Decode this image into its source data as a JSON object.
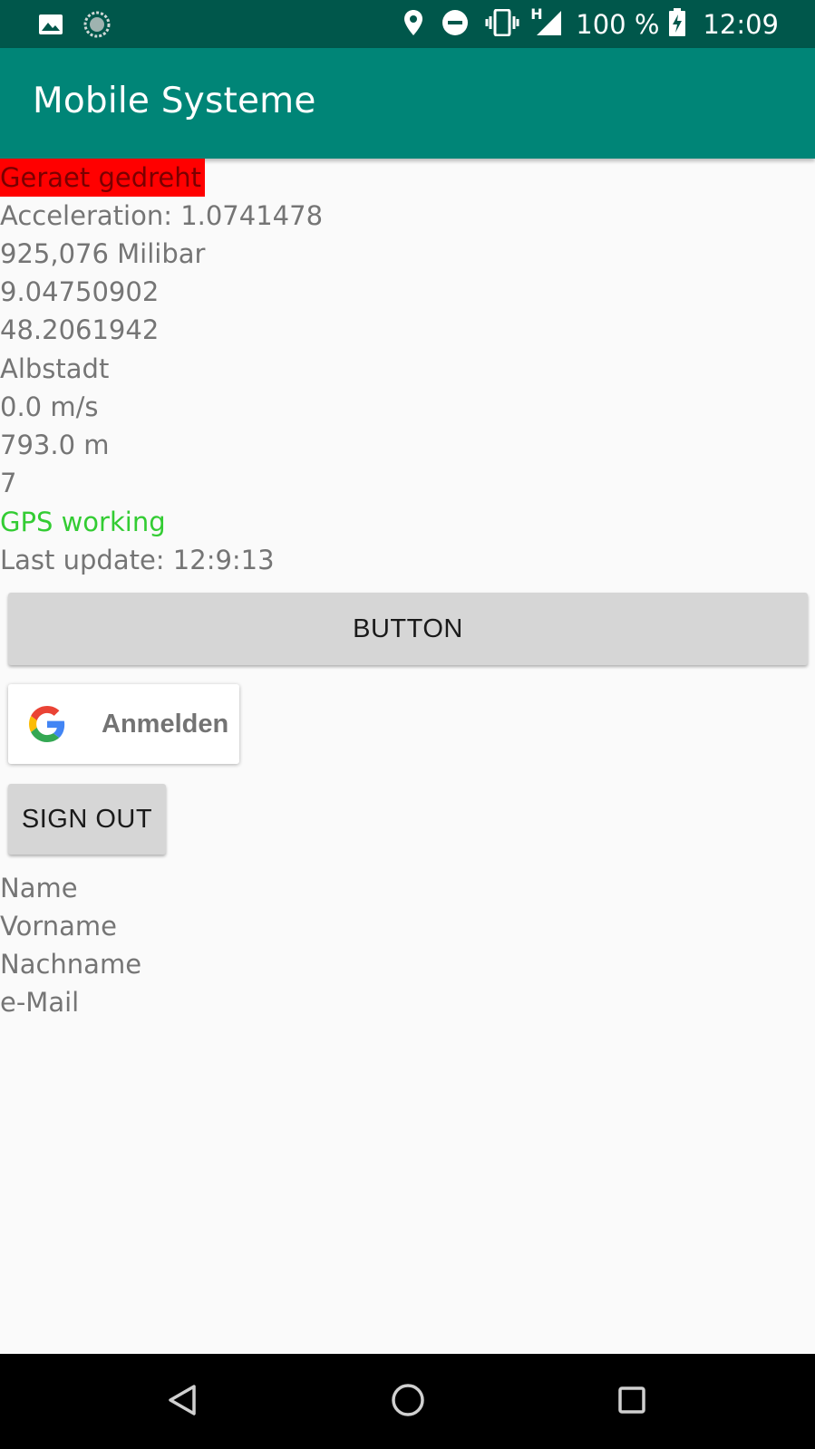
{
  "status_bar": {
    "icons_left": [
      "image-icon",
      "sync-circle-icon"
    ],
    "icons_right": [
      "location-icon",
      "do-not-disturb-icon",
      "vibrate-icon",
      "signal-h-icon",
      "battery-charging-icon"
    ],
    "network_label": "H",
    "battery": "100 %",
    "time": "12:09"
  },
  "app_bar": {
    "title": "Mobile Systeme"
  },
  "sensors": {
    "orientation_status": "Geraet gedreht",
    "acceleration": "Acceleration: 1.0741478",
    "pressure": "925,076 Milibar",
    "longitude": "9.04750902",
    "latitude": "48.2061942",
    "city": "Albstadt",
    "speed": "0.0 m/s",
    "altitude": "793.0 m",
    "satellites": "7",
    "gps_status": "GPS working",
    "last_update": "Last update: 12:9:13"
  },
  "buttons": {
    "main": "BUTTON",
    "google_sign_in": "Anmelden",
    "sign_out": "SIGN OUT"
  },
  "profile": {
    "name": "Name",
    "first_name": "Vorname",
    "last_name": "Nachname",
    "email": "e-Mail"
  },
  "colors": {
    "status_bar": "#00574b",
    "app_bar": "#008577",
    "warning_bg": "#ff0000",
    "gps_ok": "#33cc33",
    "button_bg": "#d6d6d6"
  },
  "nav_bar": {
    "icons": [
      "back-icon",
      "home-icon",
      "recents-icon"
    ]
  }
}
